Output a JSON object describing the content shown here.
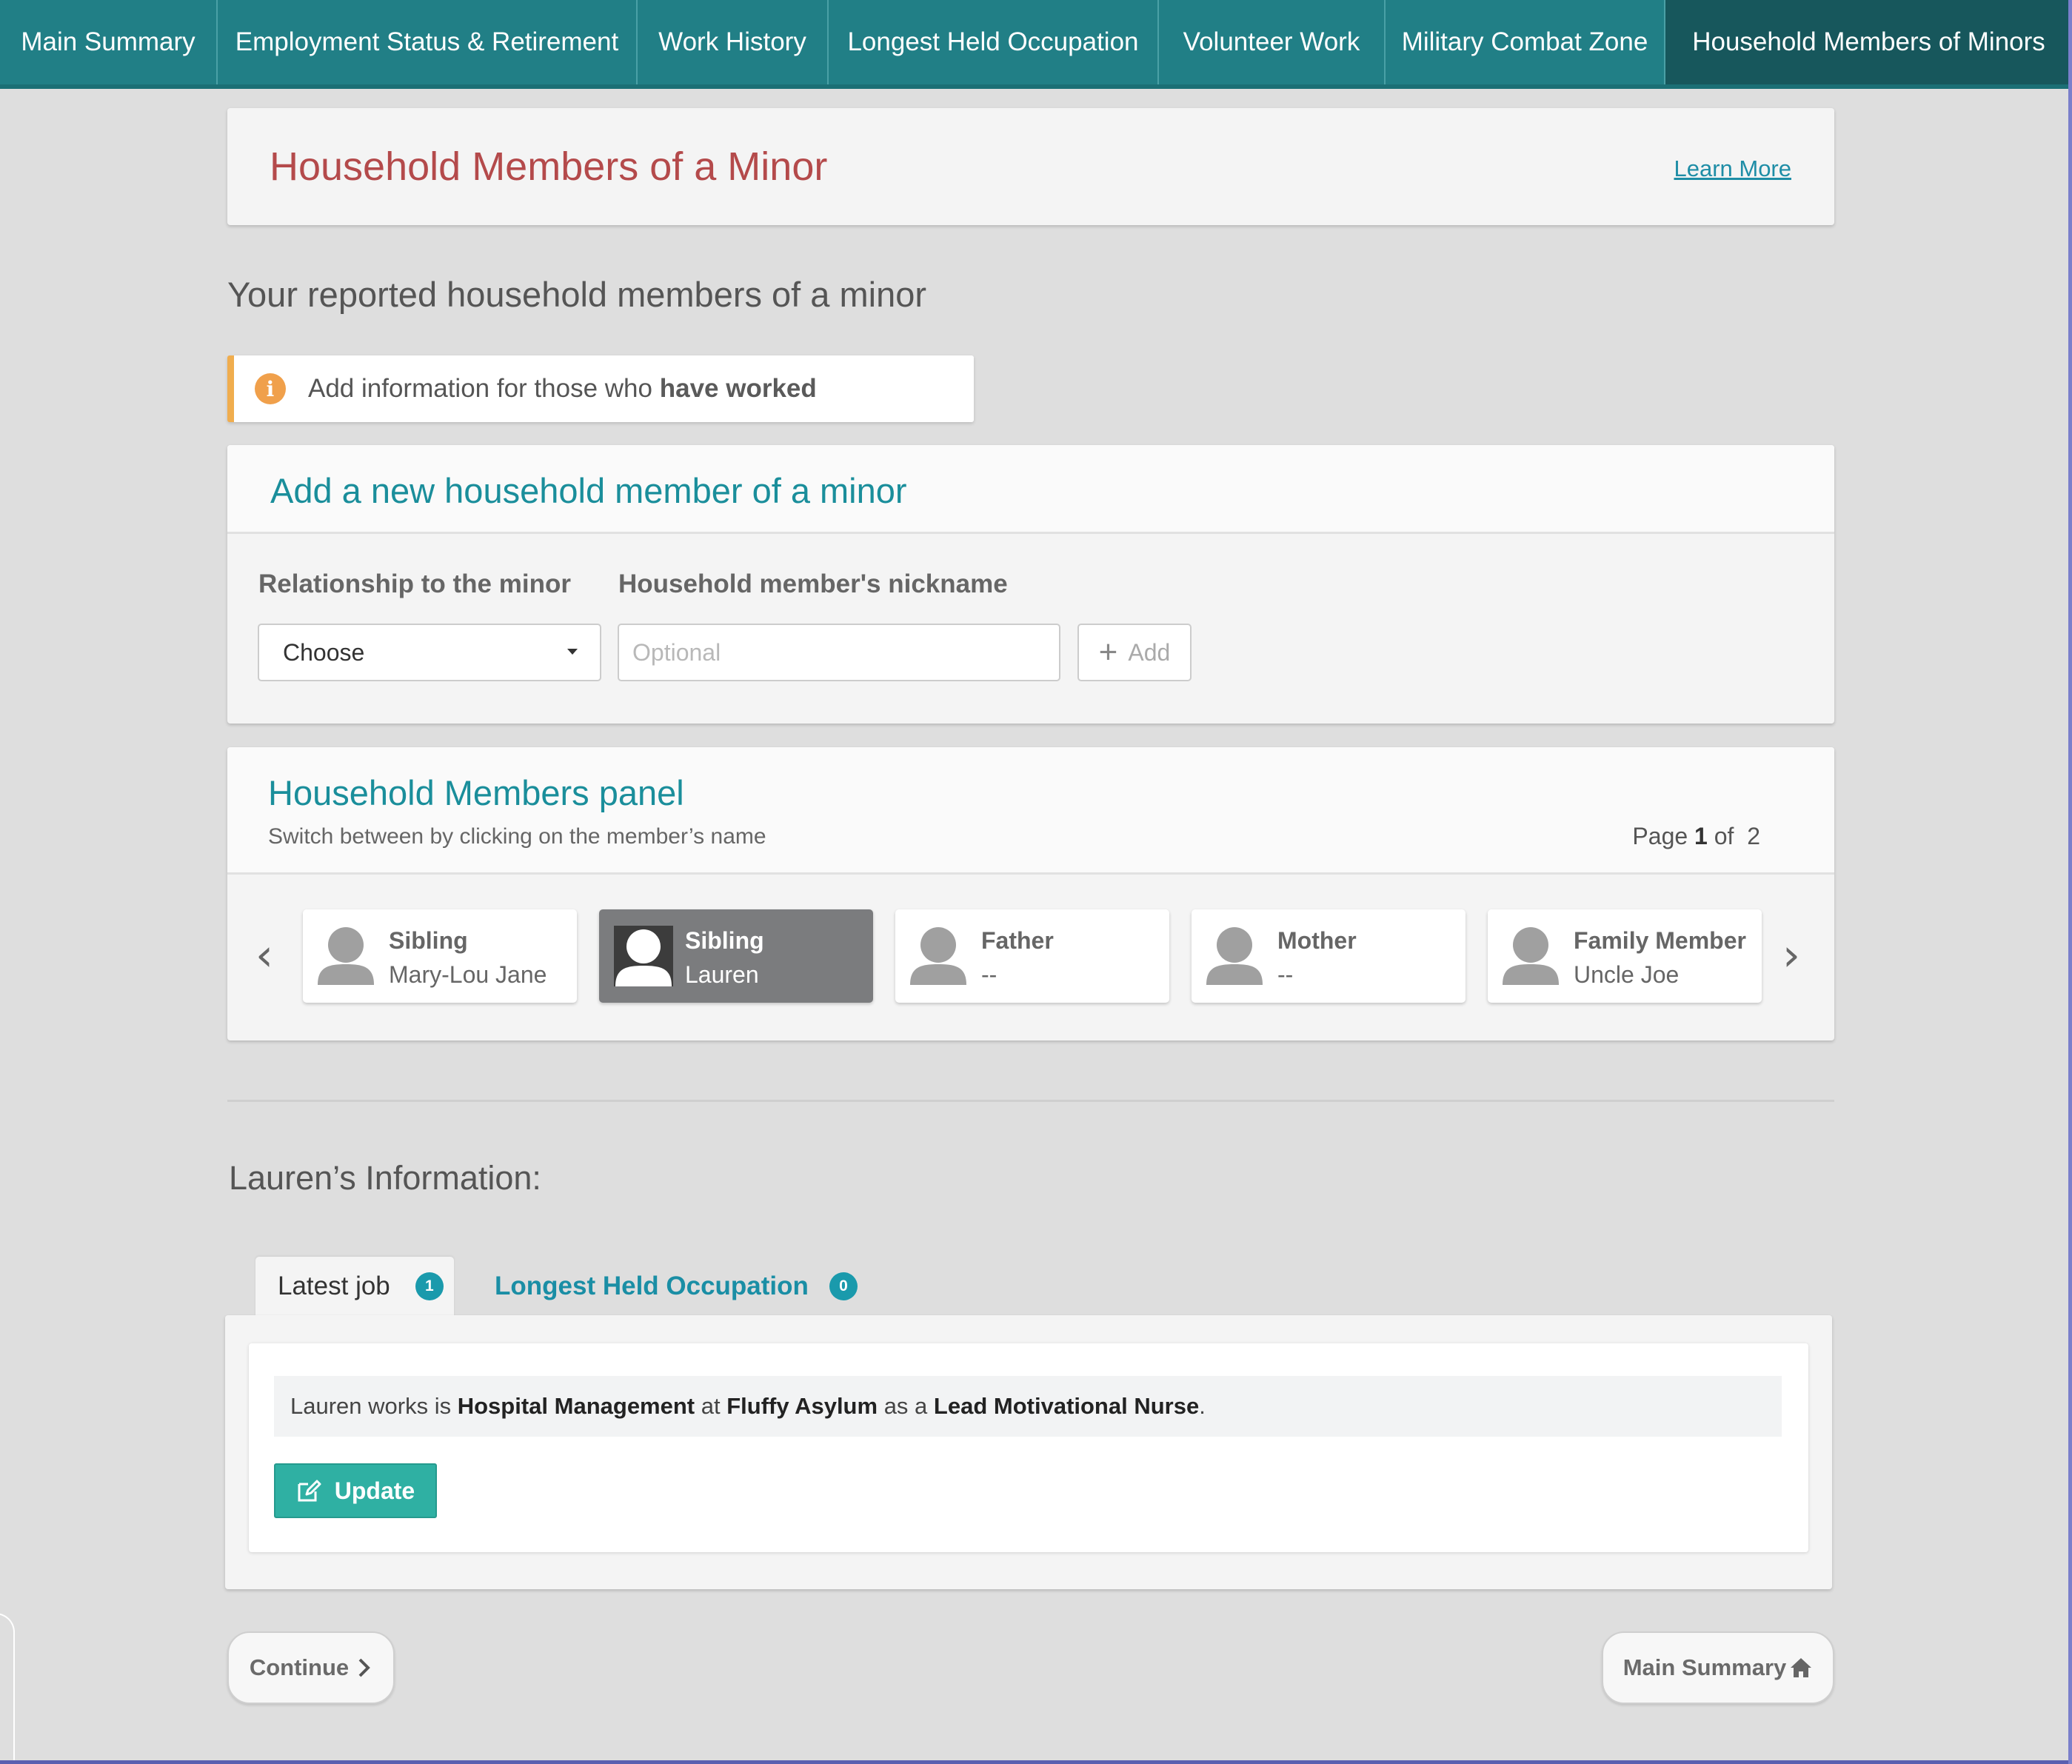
{
  "nav": {
    "tabs": [
      {
        "label": "Main Summary"
      },
      {
        "label": "Employment Status & Retirement"
      },
      {
        "label": "Work History"
      },
      {
        "label": "Longest Held Occupation"
      },
      {
        "label": "Volunteer Work"
      },
      {
        "label": "Military Combat Zone"
      },
      {
        "label": "Household Members of Minors"
      }
    ],
    "active_index": 6
  },
  "header": {
    "title": "Household Members of a Minor",
    "learn_more": "Learn More"
  },
  "subtitle": "Your reported household members of a minor",
  "notice": {
    "icon": "info-icon",
    "text_prefix": "Add information for those who ",
    "text_bold": "have worked"
  },
  "add_form": {
    "title": "Add a new household member of a minor",
    "relationship_label": "Relationship to the minor",
    "relationship_value": "Choose",
    "nickname_label": "Household member's nickname",
    "nickname_placeholder": "Optional",
    "add_label": "Add"
  },
  "members_panel": {
    "title": "Household Members panel",
    "subtitle": "Switch between by clicking on the member’s name",
    "page_prefix": "Page",
    "page_current": "1",
    "page_of": "of",
    "page_total": "2",
    "members": [
      {
        "role": "Sibling",
        "nickname": "Mary-Lou Jane",
        "selected": false
      },
      {
        "role": "Sibling",
        "nickname": "Lauren",
        "selected": true
      },
      {
        "role": "Father",
        "nickname": "--",
        "selected": false
      },
      {
        "role": "Mother",
        "nickname": "--",
        "selected": false
      },
      {
        "role": "Family Member",
        "nickname": "Uncle Joe",
        "selected": false
      }
    ]
  },
  "detail": {
    "heading": "Lauren’s Information:",
    "tabs": [
      {
        "label": "Latest job",
        "count": "1"
      },
      {
        "label": "Longest Held Occupation",
        "count": "0"
      }
    ],
    "job": {
      "name": "Lauren",
      "w1": "works is",
      "industry": "Hospital Management",
      "w2": "at",
      "employer": "Fluffy Asylum",
      "w3": "as a",
      "title": "Lead Motivational Nurse",
      "end": "."
    },
    "update_label": "Update"
  },
  "footer": {
    "continue_label": "Continue",
    "main_summary_label": "Main Summary"
  },
  "colors": {
    "nav_bg": "#217f86",
    "nav_active": "#17575c",
    "title_red": "#b44a4b",
    "teal_heading": "#1a8e9b",
    "update_btn": "#2fb0a3",
    "notice_border": "#f0ad4e"
  }
}
